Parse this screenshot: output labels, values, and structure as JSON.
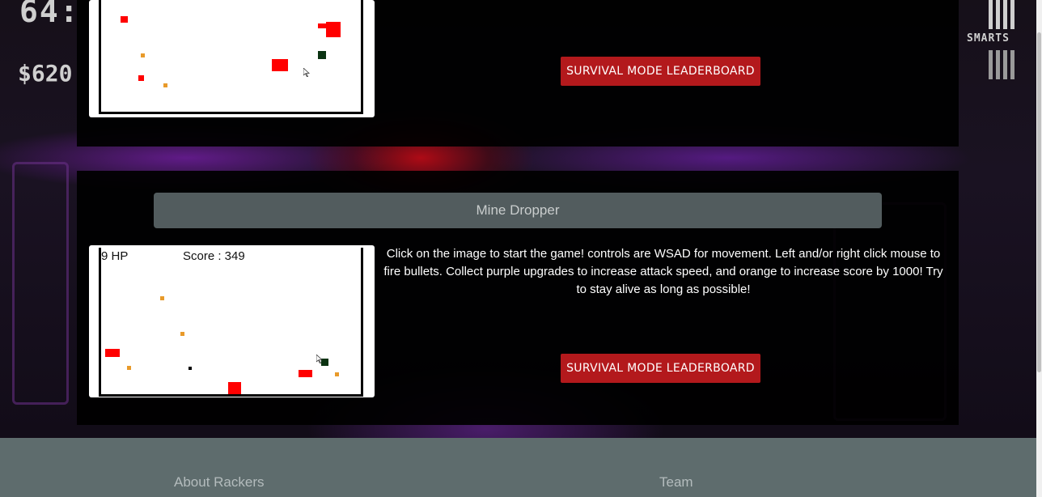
{
  "background": {
    "hud_number": "64:",
    "hud_money": "$620",
    "hud_label": "SMARTS"
  },
  "top_section": {
    "leaderboard_button": "SURVIVAL MODE LEADERBOARD"
  },
  "mine_dropper": {
    "title": "Mine Dropper",
    "hp_text": "9 HP",
    "score_text": "Score : 349",
    "description": "Click on the image to start the game! controls are WSAD for movement. Left and/or right click mouse to fire bullets. Collect purple upgrades to increase attack speed, and orange to increase score by 1000! Try to stay alive as long as possible!",
    "leaderboard_button": "SURVIVAL MODE LEADERBOARD"
  },
  "footer": {
    "about_label": "About Rackers",
    "team_label": "Team"
  },
  "colors": {
    "button_red": "#b3191c",
    "title_bar": "#525c5e",
    "footer_bg": "#5e6c6d"
  }
}
